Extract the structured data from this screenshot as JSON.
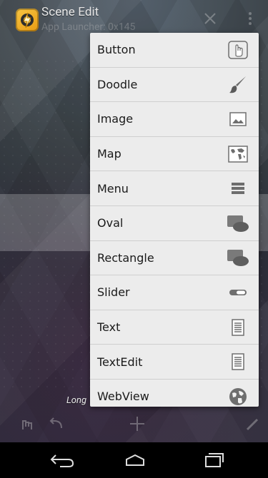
{
  "app": {
    "title": "Scene Edit",
    "subtitle": "App Launcher: 0x145"
  },
  "hint": "Long",
  "menu": {
    "items": [
      {
        "label": "Button",
        "icon": "touch-hand-icon"
      },
      {
        "label": "Doodle",
        "icon": "paintbrush-icon"
      },
      {
        "label": "Image",
        "icon": "image-icon"
      },
      {
        "label": "Map",
        "icon": "map-icon"
      },
      {
        "label": "Menu",
        "icon": "menu-list-icon"
      },
      {
        "label": "Oval",
        "icon": "oval-icon"
      },
      {
        "label": "Rectangle",
        "icon": "rectangle-icon"
      },
      {
        "label": "Slider",
        "icon": "slider-icon"
      },
      {
        "label": "Text",
        "icon": "text-doc-icon"
      },
      {
        "label": "TextEdit",
        "icon": "textedit-doc-icon"
      },
      {
        "label": "WebView",
        "icon": "globe-icon"
      }
    ]
  },
  "nav": {
    "back": "back-icon",
    "home": "home-icon",
    "recents": "recents-icon"
  },
  "colors": {
    "menu_bg": "#ececec",
    "divider": "#cfcfcf",
    "icon_gray": "#6e6e6e"
  }
}
